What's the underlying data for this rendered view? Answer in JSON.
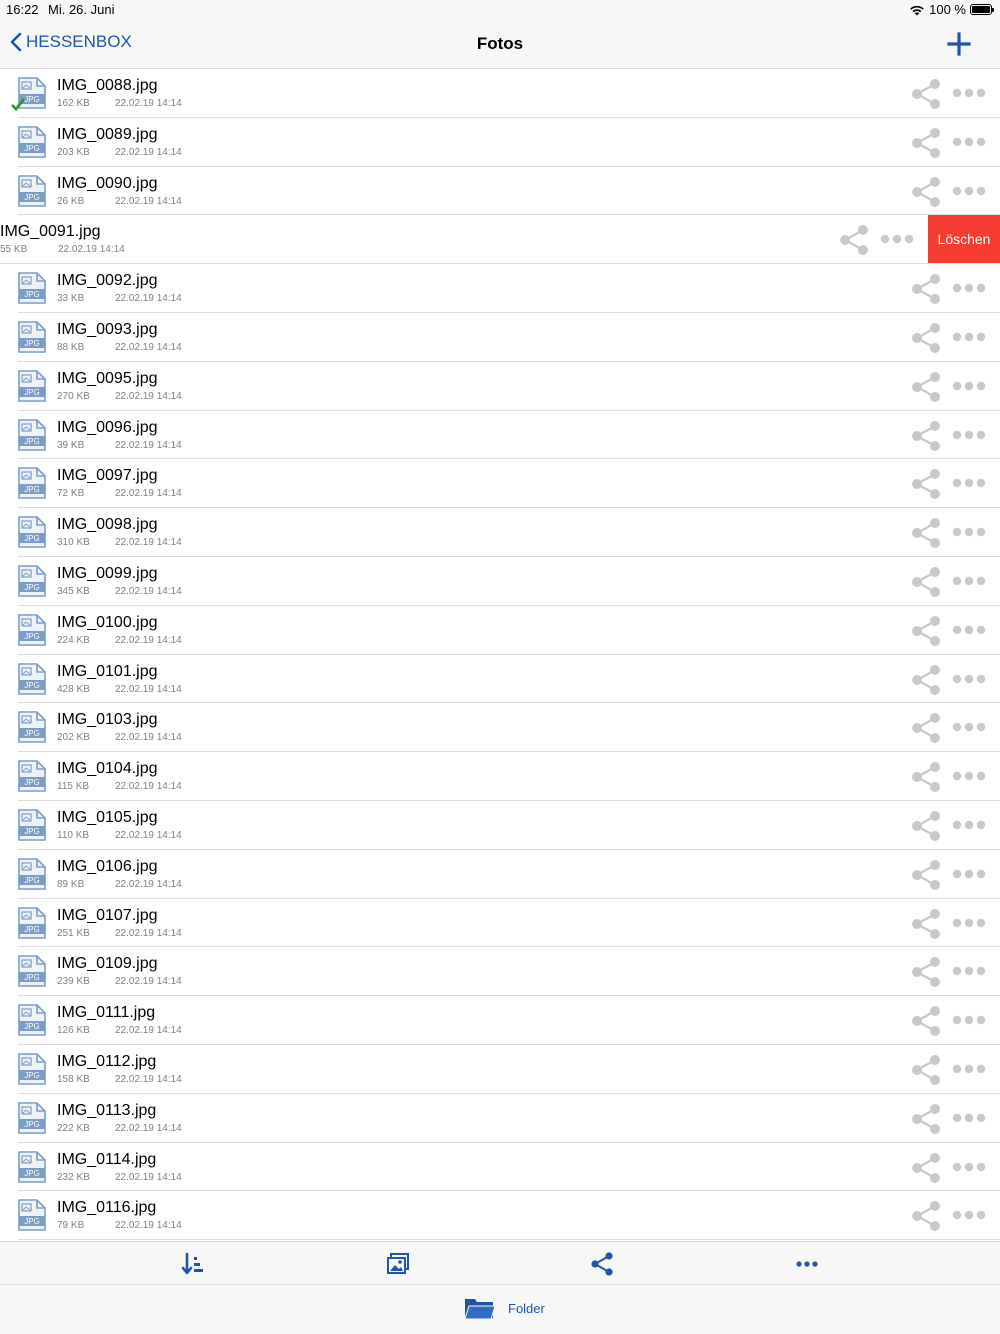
{
  "status_bar": {
    "time": "16:22",
    "date": "Mi. 26. Juni",
    "battery": "100 %"
  },
  "nav": {
    "back_label": "HESSENBOX",
    "title": "Fotos"
  },
  "colors": {
    "accent": "#1e55a5",
    "delete": "#f63c31",
    "icon_gray": "#c8c8c8",
    "file_icon": "#7a9cc6",
    "check": "#1a9a2a"
  },
  "files": [
    {
      "name": "IMG_0088.jpg",
      "size": "162 KB",
      "date": "22.02.19 14:14",
      "synced": true
    },
    {
      "name": "IMG_0089.jpg",
      "size": "203 KB",
      "date": "22.02.19 14:14"
    },
    {
      "name": "IMG_0090.jpg",
      "size": "26 KB",
      "date": "22.02.19 14:14"
    },
    {
      "name": "IMG_0091.jpg",
      "size": "55 KB",
      "date": "22.02.19 14:14",
      "swiped": true
    },
    {
      "name": "IMG_0092.jpg",
      "size": "33 KB",
      "date": "22.02.19 14:14"
    },
    {
      "name": "IMG_0093.jpg",
      "size": "88 KB",
      "date": "22.02.19 14:14"
    },
    {
      "name": "IMG_0095.jpg",
      "size": "270 KB",
      "date": "22.02.19 14:14"
    },
    {
      "name": "IMG_0096.jpg",
      "size": "39 KB",
      "date": "22.02.19 14:14"
    },
    {
      "name": "IMG_0097.jpg",
      "size": "72 KB",
      "date": "22.02.19 14:14"
    },
    {
      "name": "IMG_0098.jpg",
      "size": "310 KB",
      "date": "22.02.19 14:14"
    },
    {
      "name": "IMG_0099.jpg",
      "size": "345 KB",
      "date": "22.02.19 14:14"
    },
    {
      "name": "IMG_0100.jpg",
      "size": "224 KB",
      "date": "22.02.19 14:14"
    },
    {
      "name": "IMG_0101.jpg",
      "size": "428 KB",
      "date": "22.02.19 14:14"
    },
    {
      "name": "IMG_0103.jpg",
      "size": "202 KB",
      "date": "22.02.19 14:14"
    },
    {
      "name": "IMG_0104.jpg",
      "size": "115 KB",
      "date": "22.02.19 14:14"
    },
    {
      "name": "IMG_0105.jpg",
      "size": "110 KB",
      "date": "22.02.19 14:14"
    },
    {
      "name": "IMG_0106.jpg",
      "size": "89 KB",
      "date": "22.02.19 14:14"
    },
    {
      "name": "IMG_0107.jpg",
      "size": "251 KB",
      "date": "22.02.19 14:14"
    },
    {
      "name": "IMG_0109.jpg",
      "size": "239 KB",
      "date": "22.02.19 14:14"
    },
    {
      "name": "IMG_0111.jpg",
      "size": "126 KB",
      "date": "22.02.19 14:14"
    },
    {
      "name": "IMG_0112.jpg",
      "size": "158 KB",
      "date": "22.02.19 14:14"
    },
    {
      "name": "IMG_0113.jpg",
      "size": "222 KB",
      "date": "22.02.19 14:14"
    },
    {
      "name": "IMG_0114.jpg",
      "size": "232 KB",
      "date": "22.02.19 14:14"
    },
    {
      "name": "IMG_0116.jpg",
      "size": "79 KB",
      "date": "22.02.19 14:14"
    }
  ],
  "file_icon_label": "JPG",
  "row_actions": {
    "delete_label": "Löschen",
    "share_icon": "share-icon",
    "more_icon": "more-icon"
  },
  "toolbar": {
    "sort_icon": "sort-icon",
    "gallery_icon": "gallery-icon",
    "share_icon": "share-icon",
    "more_icon": "more-icon"
  },
  "tab_bar": {
    "folder_label": "Folder"
  }
}
